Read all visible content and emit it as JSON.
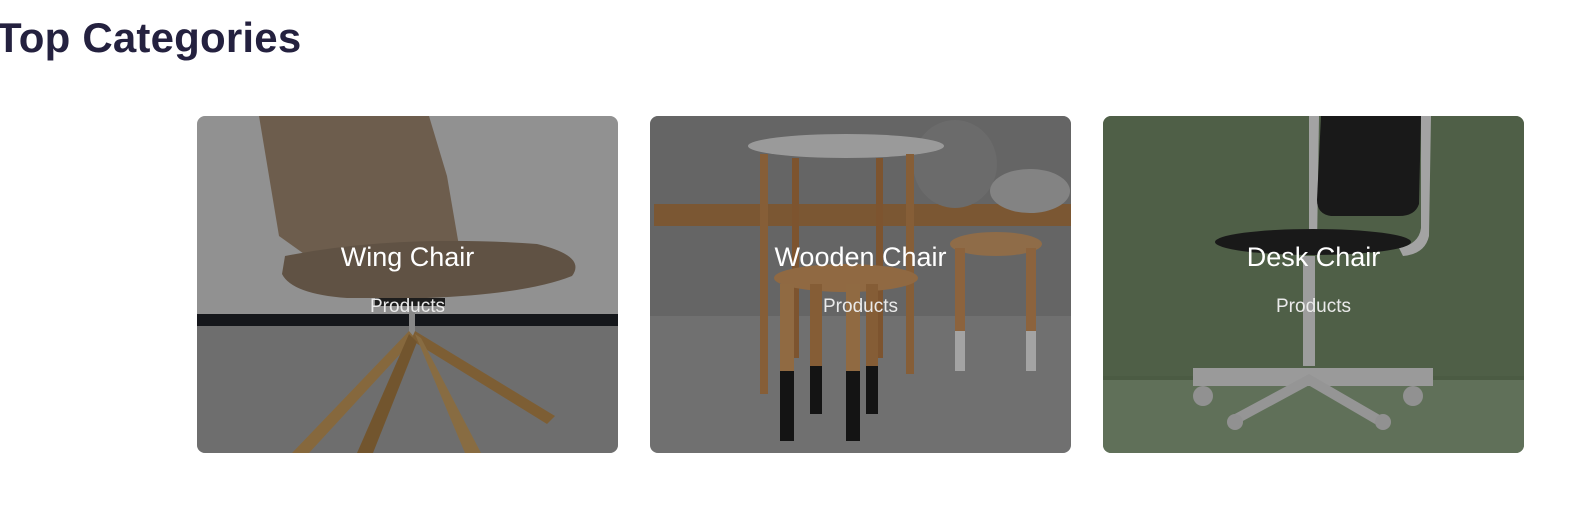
{
  "section": {
    "title": "Top Categories"
  },
  "categories": [
    {
      "name": "Wing Chair",
      "subtitle": "Products",
      "icon": "wing-chair-image",
      "bg_color": "#a9a8a6"
    },
    {
      "name": "Wooden Chair",
      "subtitle": "Products",
      "icon": "wooden-stool-image",
      "bg_color": "#7d7a76"
    },
    {
      "name": "Desk Chair",
      "subtitle": "Products",
      "icon": "desk-chair-image",
      "bg_color": "#6f7f66"
    }
  ]
}
